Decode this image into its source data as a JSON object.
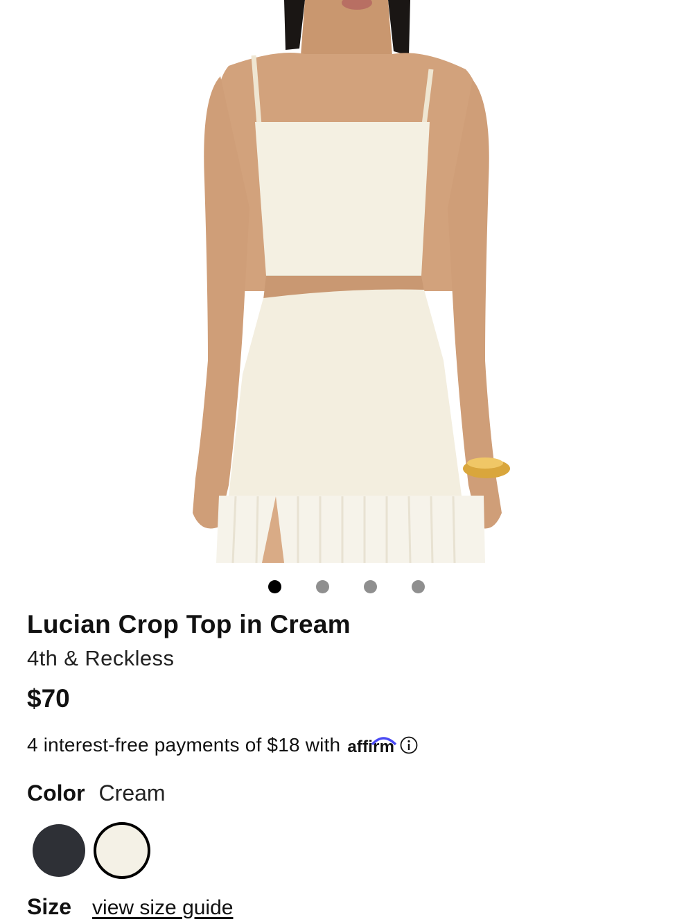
{
  "product": {
    "title": "Lucian Crop Top in Cream",
    "brand": "4th & Reckless",
    "price": "$70",
    "installments_text": "4 interest-free payments of $18 with",
    "affirm_logo_text": "affirm",
    "info_icon": "info-icon"
  },
  "carousel": {
    "image_count": 4,
    "active_index": 0
  },
  "color": {
    "label": "Color",
    "selected": "Cream",
    "swatches": [
      {
        "name": "black",
        "hex": "#2e3036"
      },
      {
        "name": "cream",
        "hex": "#f4f1e6"
      }
    ]
  },
  "size": {
    "label": "Size",
    "guide_link": "view size guide"
  }
}
